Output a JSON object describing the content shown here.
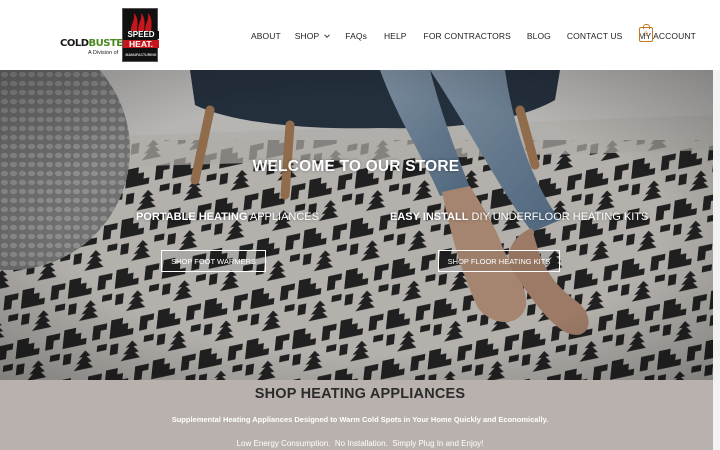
{
  "logo": {
    "brand_part1": "COLD",
    "brand_part2": "BUSTER",
    "division_text": "A Division of",
    "parent_line1": "SPEED",
    "parent_line2": "HEAT.",
    "parent_line3": "MANUFACTURING"
  },
  "nav": {
    "items": [
      {
        "label": "ABOUT",
        "name": "nav-about",
        "has_dropdown": false
      },
      {
        "label": "SHOP",
        "name": "nav-shop",
        "has_dropdown": true
      },
      {
        "label": "FAQs",
        "name": "nav-faqs",
        "has_dropdown": false
      },
      {
        "label": "HELP",
        "name": "nav-help",
        "has_dropdown": false
      },
      {
        "label": "FOR CONTRACTORS",
        "name": "nav-for-contractors",
        "has_dropdown": false
      },
      {
        "label": "BLOG",
        "name": "nav-blog",
        "has_dropdown": false
      },
      {
        "label": "CONTACT US",
        "name": "nav-contact-us",
        "has_dropdown": false
      },
      {
        "label": "MY ACCOUNT",
        "name": "nav-my-account",
        "has_dropdown": false
      }
    ],
    "cart_count": "0"
  },
  "hero": {
    "title_bold": "WELCOME",
    "title_rest": " TO OUR STORE",
    "left": {
      "heading_bold": "PORTABLE HEATING",
      "heading_rest": " APPLIANCES",
      "button_label": "SHOP FOOT WARMERS"
    },
    "right": {
      "heading_bold": "EASY INSTALL",
      "heading_rest": " DIY UNDERFLOOR HEATING KITS",
      "button_label": "SHOP FLOOR HEATING KITS"
    }
  },
  "shop_section": {
    "heading_bold": "SHOP",
    "heading_rest": " HEATING APPLIANCES",
    "subtitle": "Supplemental Heating Appliances Designed to Warm Cold Spots in Your Home Quickly and Economically.",
    "features": "Low Energy Consumption.  No Installation.  Simply Plug In and Enjoy!"
  },
  "colors": {
    "accent": "#c4781a",
    "brand_green": "#4a8a1c",
    "brand_red": "#c4161c",
    "shop_section_bg": "#b9b1ad"
  }
}
